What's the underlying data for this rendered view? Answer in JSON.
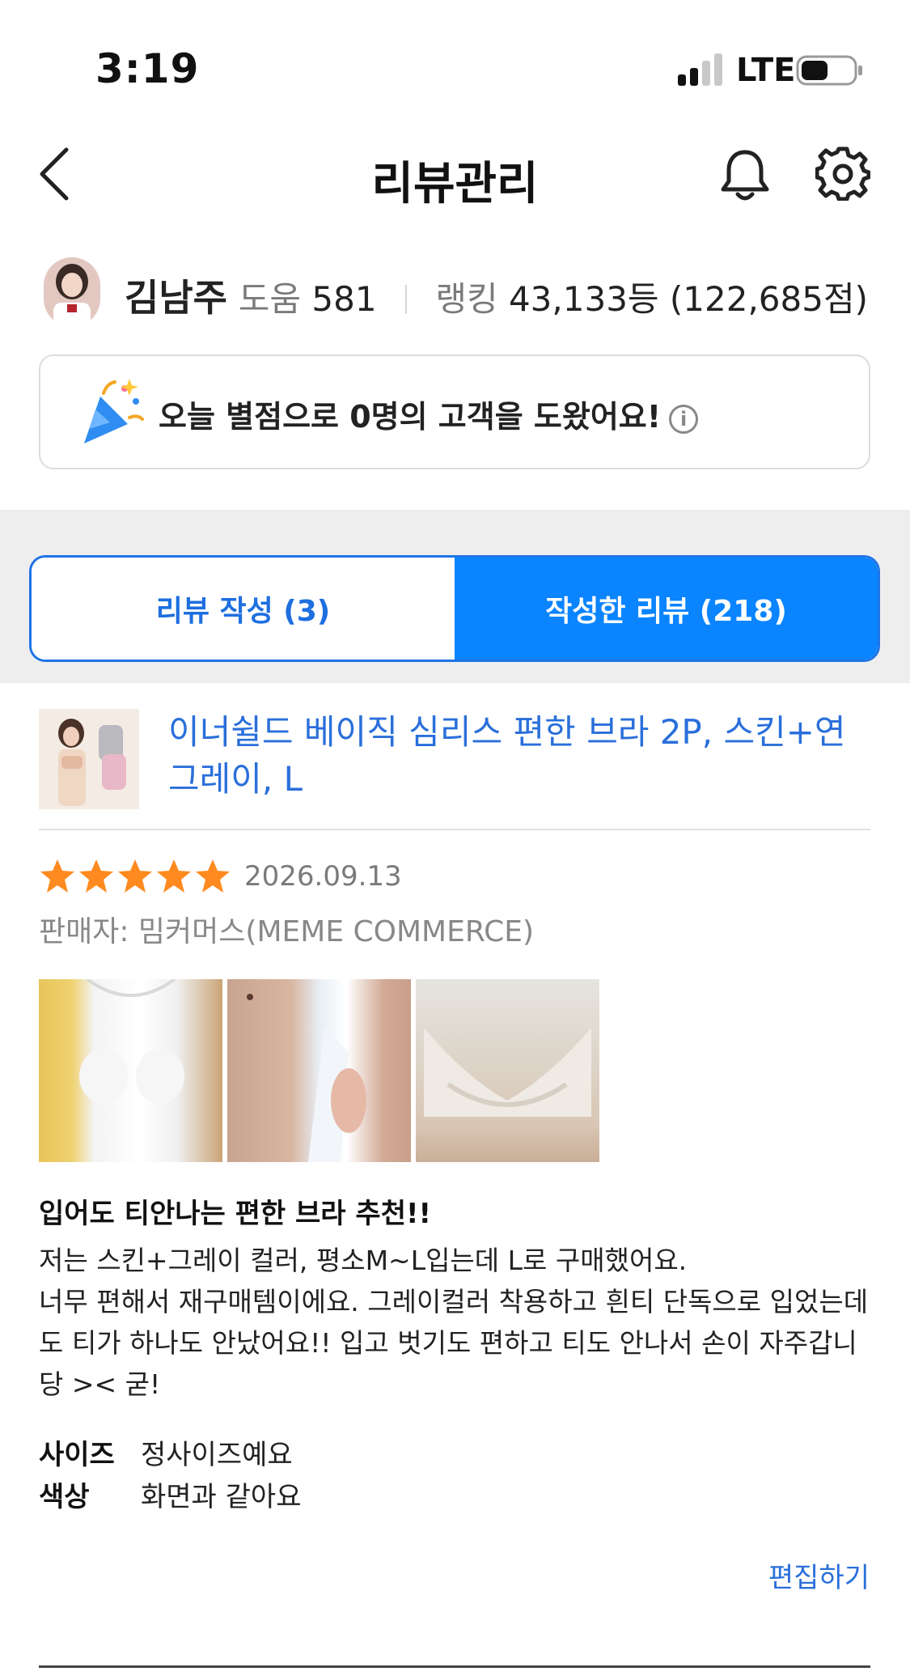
{
  "status_bar": {
    "time": "3:19",
    "network": "LTE"
  },
  "header": {
    "title": "리뷰관리"
  },
  "profile": {
    "name": "김남주",
    "help_label": "도움",
    "help_count": "581",
    "ranking_label": "랭킹",
    "ranking_value": "43,133등 (122,685점)"
  },
  "banner": {
    "text": "오늘 별점으로 0명의 고객을 도왔어요!"
  },
  "tabs": [
    {
      "label": "리뷰 작성 (3)",
      "active": false
    },
    {
      "label": "작성한 리뷰 (218)",
      "active": true
    }
  ],
  "review": {
    "product_name": "이너쉴드 베이직 심리스 편한 브라 2P, 스킨+연그레이, L",
    "rating": 5,
    "date": "2026.09.13",
    "seller": "판매자: 밈커머스(MEME COMMERCE)",
    "title": "입어도 티안나는 편한 브라 추천!!",
    "body": "저는 스킨+그레이 컬러, 평소M~L입는데 L로 구매했어요.\n너무 편해서 재구매템이에요. 그레이컬러 착용하고 흰티 단독으로 입었는데도 티가 하나도 안났어요!! 입고 벗기도 편하고 티도 안나서 손이 자주갑니당 >< 굳!",
    "attributes": [
      {
        "key": "사이즈",
        "value": "정사이즈예요"
      },
      {
        "key": "색상",
        "value": "화면과 같아요"
      }
    ],
    "edit_label": "편집하기"
  },
  "colors": {
    "accent": "#0a84ff",
    "link": "#2a6fdb",
    "star": "#ff8a1f"
  }
}
